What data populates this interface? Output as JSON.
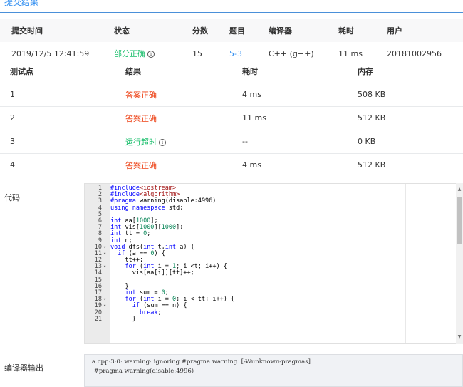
{
  "section_title": "提交结果",
  "submission": {
    "headers": [
      "提交时间",
      "状态",
      "分数",
      "题目",
      "编译器",
      "耗时",
      "用户"
    ],
    "row": {
      "time": "2019/12/5 12:41:59",
      "status": "部分正确",
      "score": "15",
      "problem": "5-3",
      "compiler": "C++ (g++)",
      "elapsed": "11 ms",
      "user": "20181002956"
    }
  },
  "info_icon_glyph": "i",
  "cases": {
    "headers": [
      "测试点",
      "结果",
      "耗时",
      "内存"
    ],
    "rows": [
      {
        "id": "1",
        "result": "答案正确",
        "time": "4 ms",
        "memory": "508 KB"
      },
      {
        "id": "2",
        "result": "答案正确",
        "time": "11 ms",
        "memory": "512 KB"
      },
      {
        "id": "3",
        "result": "运行超时",
        "time": "--",
        "memory": "0 KB"
      },
      {
        "id": "4",
        "result": "答案正确",
        "time": "4 ms",
        "memory": "512 KB"
      }
    ]
  },
  "code_label": "代码",
  "code_lines": [
    {
      "n": "1",
      "fold": "",
      "text": "#include<iostream>"
    },
    {
      "n": "2",
      "fold": "",
      "text": "#include<algorithm>"
    },
    {
      "n": "3",
      "fold": "",
      "text": "#pragma warning(disable:4996)"
    },
    {
      "n": "4",
      "fold": "",
      "text": "using namespace std;"
    },
    {
      "n": "5",
      "fold": "",
      "text": ""
    },
    {
      "n": "6",
      "fold": "",
      "text": "int aa[1000];"
    },
    {
      "n": "7",
      "fold": "",
      "text": "int vis[1000][1000];"
    },
    {
      "n": "8",
      "fold": "",
      "text": "int tt = 0;"
    },
    {
      "n": "9",
      "fold": "",
      "text": "int n;"
    },
    {
      "n": "10",
      "fold": "▾",
      "text": "void dfs(int t,int a) {"
    },
    {
      "n": "11",
      "fold": "▾",
      "text": "  if (a == 0) {"
    },
    {
      "n": "12",
      "fold": "",
      "text": "    tt++;"
    },
    {
      "n": "13",
      "fold": "▾",
      "text": "    for (int i = 1; i <t; i++) {"
    },
    {
      "n": "14",
      "fold": "",
      "text": "      vis[aa[i]][tt]++;"
    },
    {
      "n": "15",
      "fold": "",
      "text": ""
    },
    {
      "n": "16",
      "fold": "",
      "text": "    }"
    },
    {
      "n": "17",
      "fold": "",
      "text": "    int sum = 0;"
    },
    {
      "n": "18",
      "fold": "▾",
      "text": "    for (int i = 0; i < tt; i++) {"
    },
    {
      "n": "19",
      "fold": "▾",
      "text": "      if (sum == n) {"
    },
    {
      "n": "20",
      "fold": "",
      "text": "        break;"
    },
    {
      "n": "21",
      "fold": "",
      "text": "      }"
    }
  ],
  "compiler_label": "编译器输出",
  "compiler_output": "a.cpp:3:0: warning: ignoring #pragma warning  [-Wunknown-pragmas]\n #pragma warning(disable:4996)",
  "scroll_up_glyph": "▲",
  "scroll_down_glyph": "▼"
}
